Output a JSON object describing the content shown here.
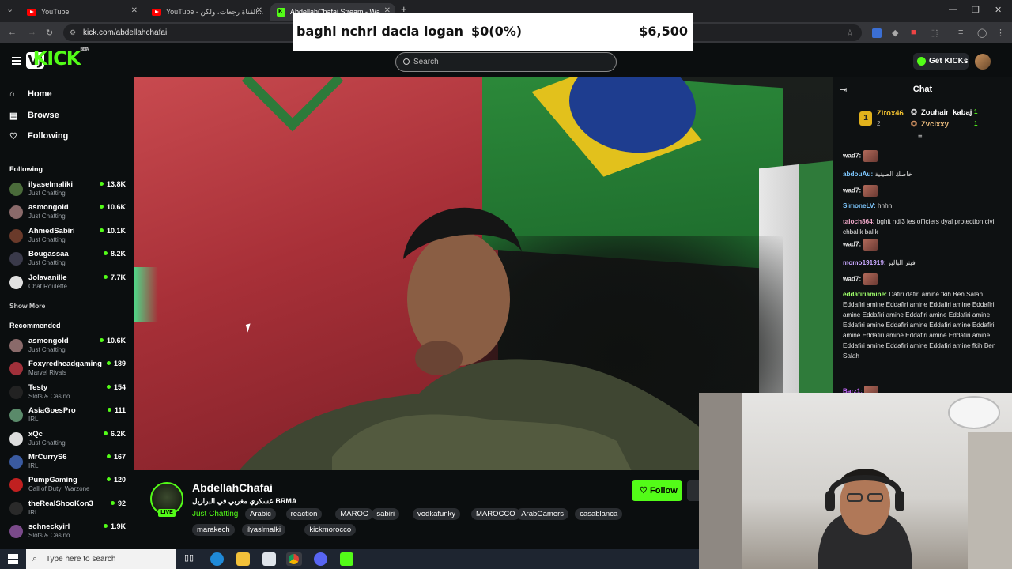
{
  "browser": {
    "tabs": [
      {
        "label": "YouTube",
        "icon": "youtube-icon"
      },
      {
        "label": "YouTube - القناة رجعات، ولكن...",
        "icon": "youtube-icon"
      },
      {
        "label": "AbdellahChafai Stream - Wa...",
        "icon": "kick-icon"
      }
    ],
    "new_tab": "+",
    "url": "kick.com/abdellahchafai"
  },
  "banner": {
    "text": "baghi nchri dacia logan",
    "progress": "$0(0%)",
    "goal": "$6,500"
  },
  "kick": {
    "logo": "KICK",
    "logo_prefix": "VJ",
    "logo_tag": "BETA",
    "search_placeholder": "Search",
    "get_kicks": "Get KICKs"
  },
  "sidebar": {
    "nav": [
      {
        "label": "Home",
        "icon": "home-icon"
      },
      {
        "label": "Browse",
        "icon": "browse-icon"
      },
      {
        "label": "Following",
        "icon": "heart-icon"
      }
    ],
    "following_title": "Following",
    "following": [
      {
        "name": "ilyaselmaliki",
        "category": "Just Chatting",
        "viewers": "13.8K",
        "avatar_color": "#4a6b3a"
      },
      {
        "name": "asmongold",
        "category": "Just Chatting",
        "viewers": "10.6K",
        "avatar_color": "#8a6a6a"
      },
      {
        "name": "AhmedSabiri",
        "category": "Just Chatting",
        "viewers": "10.1K",
        "avatar_color": "#6a3a2a"
      },
      {
        "name": "Bougassaa",
        "category": "Just Chatting",
        "viewers": "8.2K",
        "avatar_color": "#3a3a4a"
      },
      {
        "name": "Jolavanille",
        "category": "Chat Roulette",
        "viewers": "7.7K",
        "avatar_color": "#e0e0e0"
      }
    ],
    "show_more": "Show More",
    "recommended_title": "Recommended",
    "recommended": [
      {
        "name": "asmongold",
        "category": "Just Chatting",
        "viewers": "10.6K",
        "avatar_color": "#8a6a6a"
      },
      {
        "name": "Foxyredheadgaming",
        "category": "Marvel Rivals",
        "viewers": "189",
        "avatar_color": "#a0303a"
      },
      {
        "name": "Testy",
        "category": "Slots & Casino",
        "viewers": "154",
        "avatar_color": "#222222"
      },
      {
        "name": "AsiaGoesPro",
        "category": "IRL",
        "viewers": "111",
        "avatar_color": "#5a8a6a"
      },
      {
        "name": "xQc",
        "category": "Just Chatting",
        "viewers": "6.2K",
        "avatar_color": "#dddddd"
      },
      {
        "name": "MrCurryS6",
        "category": "IRL",
        "viewers": "167",
        "avatar_color": "#3a5aa0"
      },
      {
        "name": "PumpGaming",
        "category": "Call of Duty: Warzone",
        "viewers": "120",
        "avatar_color": "#c02020"
      },
      {
        "name": "theRealShooKon3",
        "category": "IRL",
        "viewers": "92",
        "avatar_color": "#2a2a2a"
      },
      {
        "name": "schneckyirl",
        "category": "Slots & Casino",
        "viewers": "1.9K",
        "avatar_color": "#7a4a8a"
      }
    ]
  },
  "stream": {
    "channel": "AbdellahChafai",
    "live": "LIVE",
    "title": "عسكري مغربي في البرازيل BRMA",
    "category": "Just Chatting",
    "tags": [
      "Arabic",
      "reaction",
      "MAROC",
      "sabiri",
      "vodkafunky",
      "MAROCCO",
      "ArabGamers",
      "casablanca",
      "marakech",
      "ilyaslmalki",
      "kickmorocco"
    ],
    "follow": "Follow"
  },
  "chat": {
    "title": "Chat",
    "leaders": [
      {
        "name": "Zirox46",
        "count": "2"
      },
      {
        "name": "Zouhair_kabaj",
        "count": "1"
      },
      {
        "name": "Zvclxxy",
        "count": "1"
      }
    ],
    "messages": [
      {
        "user": "wad7:",
        "text": "",
        "emote": true,
        "color": "#e8e8e8"
      },
      {
        "user": "abdouAu:",
        "text": "خاصك الصينية",
        "emote": false,
        "color": "#7ec8ff"
      },
      {
        "user": "wad7:",
        "text": "",
        "emote": true,
        "color": "#e8e8e8"
      },
      {
        "user": "SimoneLV:",
        "text": "hhhh",
        "emote": false,
        "color": "#7ec8ff"
      },
      {
        "user": "taloch864:",
        "text": "bghit ndf3 les officiers dyal protection civil chbalik balik",
        "emote": false,
        "color": "#f0a8c8"
      },
      {
        "user": "wad7:",
        "text": "",
        "emote": true,
        "color": "#e8e8e8"
      },
      {
        "user": "momo191919:",
        "text": "فيتر البالير",
        "emote": false,
        "color": "#c8a8ff"
      },
      {
        "user": "wad7:",
        "text": "",
        "emote": true,
        "color": "#e8e8e8"
      },
      {
        "user": "eddafiriamine:",
        "text": "Dafiri dafiri amine fkih Ben Salah Eddafiri amine Eddafiri amine Eddafiri amine Eddafiri amine Eddafiri amine Eddafiri amine Eddafiri amine Eddafiri amine Eddafiri amine Eddafiri amine Eddafiri amine Eddafiri amine Eddafiri amine Eddafiri amine Eddafiri amine Eddafiri amine Eddafiri amine fkih Ben Salah",
        "emote": false,
        "color": "#9eff6a"
      },
      {
        "user": "Barz1:",
        "text": "",
        "emote": true,
        "color": "#c86aff"
      }
    ]
  },
  "taskbar": {
    "search_placeholder": "Type here to search"
  },
  "colors": {
    "accent": "#53fc18",
    "background": "#0b0e0f",
    "tag_bg": "#2a2d31"
  }
}
